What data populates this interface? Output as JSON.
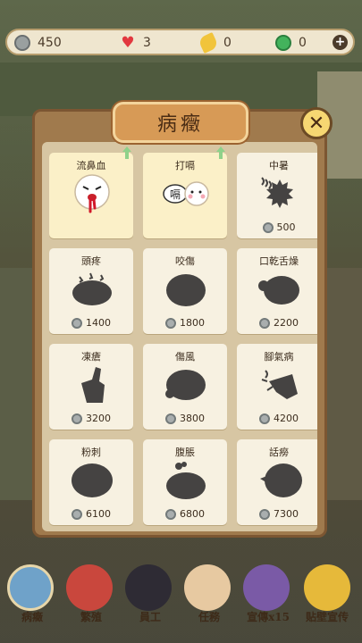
{
  "topbar": {
    "coins": "450",
    "hearts": "3",
    "leaves": "0",
    "jade": "0",
    "plus": "+"
  },
  "panel": {
    "title": "病癥",
    "close": "✕"
  },
  "diseases": [
    {
      "name": "流鼻血",
      "unlocked": true,
      "price": ""
    },
    {
      "name": "打嗝",
      "unlocked": true,
      "price": ""
    },
    {
      "name": "中暑",
      "unlocked": false,
      "price": "500"
    },
    {
      "name": "頭疼",
      "unlocked": false,
      "price": "1400"
    },
    {
      "name": "咬傷",
      "unlocked": false,
      "price": "1800"
    },
    {
      "name": "口乾舌燥",
      "unlocked": false,
      "price": "2200"
    },
    {
      "name": "凍瘡",
      "unlocked": false,
      "price": "3200"
    },
    {
      "name": "傷風",
      "unlocked": false,
      "price": "3800"
    },
    {
      "name": "腳氣病",
      "unlocked": false,
      "price": "4200"
    },
    {
      "name": "粉刺",
      "unlocked": false,
      "price": "6100"
    },
    {
      "name": "腹脹",
      "unlocked": false,
      "price": "6800"
    },
    {
      "name": "話癆",
      "unlocked": false,
      "price": "7300"
    }
  ],
  "hiccup_bubble": "嗝",
  "bottomnav": [
    {
      "label": "病癥"
    },
    {
      "label": "繁殖"
    },
    {
      "label": "員工"
    },
    {
      "label": "任務"
    },
    {
      "label": "宣傳x15"
    },
    {
      "label": "贴壁宣传"
    }
  ],
  "colors": {
    "panel": "#a07a4d",
    "panel_inner": "#d7c6a3",
    "card": "#f7f1e1",
    "card_unlocked": "#fbf0c8",
    "title_plate": "#d79a56",
    "close_button": "#f6d772",
    "silhouette": "#454342"
  }
}
